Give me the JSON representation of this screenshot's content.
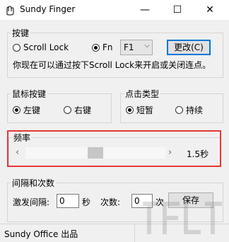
{
  "window": {
    "title": "Sundy Finger"
  },
  "hotkey": {
    "legend": "按键",
    "option_scroll_lock": "Scroll Lock",
    "option_fn": "Fn",
    "selected": "fn",
    "fn_key_value": "F1",
    "change_button": "更改(C)",
    "info": "你现在可以通过按下Scroll Lock来开启或关闭连点。"
  },
  "mouse_button": {
    "legend": "鼠标按键",
    "left": "左键",
    "right": "右键",
    "selected": "left"
  },
  "click_type": {
    "legend": "点击类型",
    "short": "短暂",
    "hold": "持续",
    "selected": "short"
  },
  "frequency": {
    "legend": "频率",
    "value_label": "1.5秒",
    "slider_value": 0.5
  },
  "interval": {
    "legend": "间隔和次数",
    "trigger_label": "激发间隔:",
    "trigger_value": "0",
    "seconds_unit": "秒",
    "count_label": "次数:",
    "count_value": "0",
    "count_unit": "次",
    "save_button": "保存"
  },
  "status": {
    "text": "Sundy Office 出品"
  }
}
